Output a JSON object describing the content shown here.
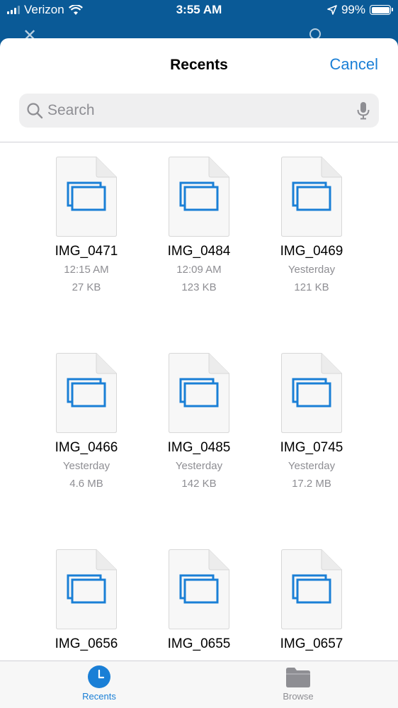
{
  "status_bar": {
    "carrier": "Verizon",
    "time": "3:55 AM",
    "battery": "99%"
  },
  "header": {
    "title": "Recents",
    "cancel_label": "Cancel"
  },
  "search": {
    "placeholder": "Search"
  },
  "files": [
    {
      "name": "IMG_0471",
      "date": "12:15 AM",
      "size": "27 KB"
    },
    {
      "name": "IMG_0484",
      "date": "12:09 AM",
      "size": "123 KB"
    },
    {
      "name": "IMG_0469",
      "date": "Yesterday",
      "size": "121 KB"
    },
    {
      "name": "IMG_0466",
      "date": "Yesterday",
      "size": "4.6 MB"
    },
    {
      "name": "IMG_0485",
      "date": "Yesterday",
      "size": "142 KB"
    },
    {
      "name": "IMG_0745",
      "date": "Yesterday",
      "size": "17.2 MB"
    },
    {
      "name": "IMG_0656",
      "date": "",
      "size": ""
    },
    {
      "name": "IMG_0655",
      "date": "",
      "size": ""
    },
    {
      "name": "IMG_0657",
      "date": "",
      "size": ""
    }
  ],
  "tabs": [
    {
      "label": "Recents",
      "active": true
    },
    {
      "label": "Browse",
      "active": false
    }
  ],
  "colors": {
    "accent": "#1a7fd6",
    "nav_background": "#0a5a97"
  }
}
